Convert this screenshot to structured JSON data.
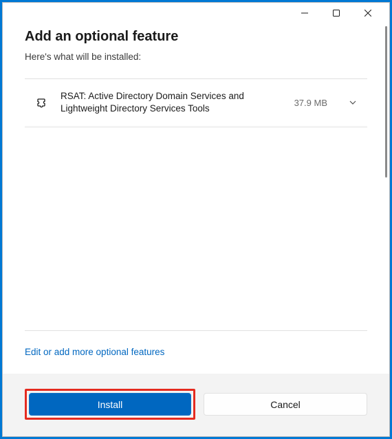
{
  "header": {
    "title": "Add an optional feature",
    "subtitle": "Here's what will be installed:"
  },
  "features": [
    {
      "name": "RSAT: Active Directory Domain Services and Lightweight Directory Services Tools",
      "size": "37.9 MB"
    }
  ],
  "link": {
    "label": "Edit or add more optional features"
  },
  "footer": {
    "install_label": "Install",
    "cancel_label": "Cancel"
  }
}
